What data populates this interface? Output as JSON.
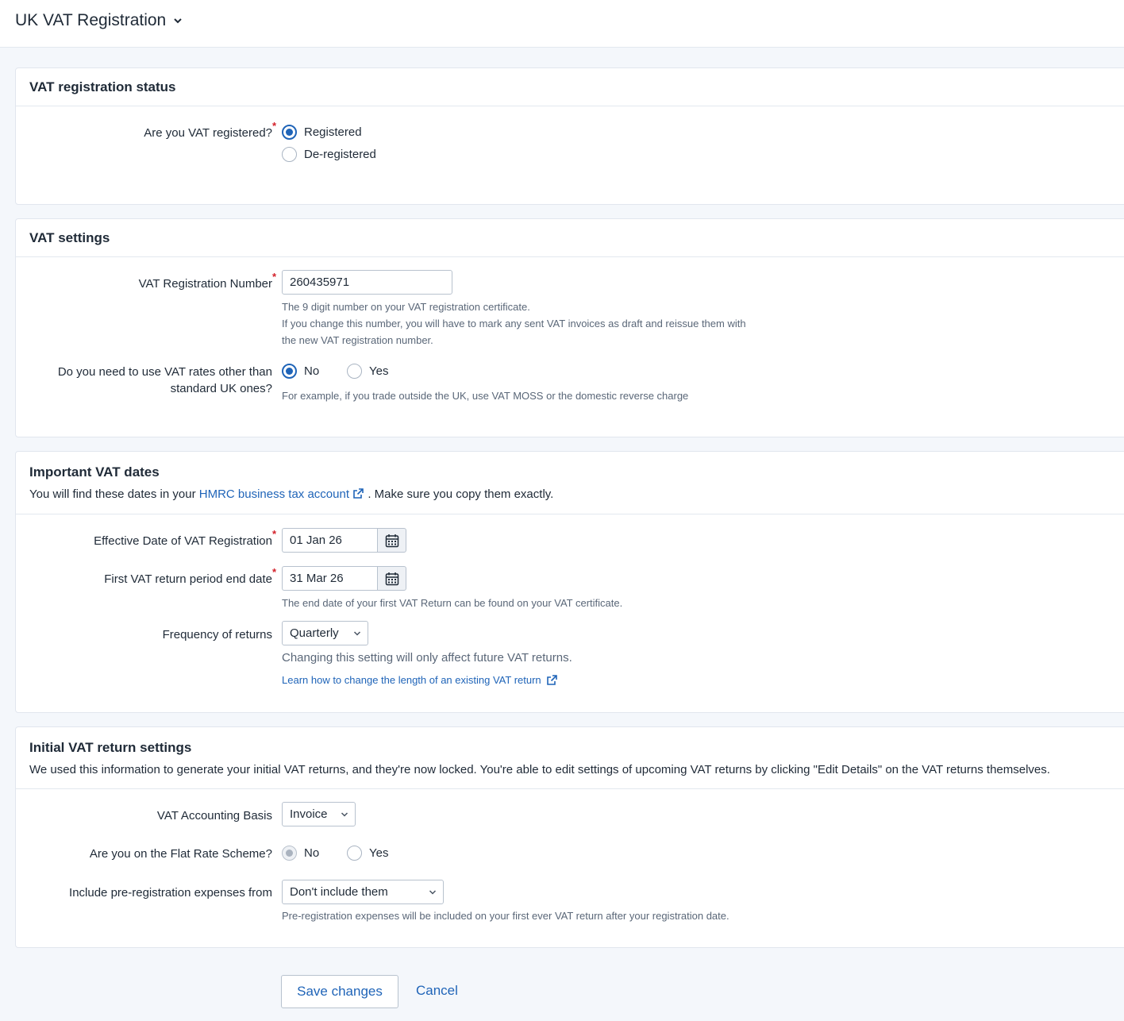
{
  "header": {
    "title": "UK VAT Registration"
  },
  "status_card": {
    "title": "VAT registration status",
    "question": "Are you VAT registered?",
    "options": [
      {
        "label": "Registered",
        "selected": true
      },
      {
        "label": "De-registered",
        "selected": false
      }
    ]
  },
  "settings_card": {
    "title": "VAT settings",
    "reg_number_label": "VAT Registration Number",
    "reg_number_value": "260435971",
    "reg_help_1": "The 9 digit number on your VAT registration certificate.",
    "reg_help_2": "If you change this number, you will have to mark any sent VAT invoices as draft and reissue them with",
    "reg_help_3": "the new VAT registration number.",
    "rates_label_1": "Do you need to use VAT rates other than",
    "rates_label_2": "standard UK ones?",
    "rates_options": [
      {
        "label": "No",
        "selected": true
      },
      {
        "label": "Yes",
        "selected": false
      }
    ],
    "rates_help": "For example, if you trade outside the UK, use VAT MOSS or the domestic reverse charge"
  },
  "dates_card": {
    "title": "Important VAT dates",
    "desc_prefix": "You will find these dates in your",
    "desc_link": "HMRC business tax account",
    "desc_suffix": ". Make sure you copy them exactly.",
    "effective_label": "Effective Date of VAT Registration",
    "effective_value": "01 Jan 26",
    "first_return_label": "First VAT return period end date",
    "first_return_value": "31 Mar 26",
    "first_return_help": "The end date of your first VAT Return can be found on your VAT certificate.",
    "frequency_label": "Frequency of returns",
    "frequency_value": "Quarterly",
    "frequency_help": "Changing this setting will only affect future VAT returns.",
    "frequency_link": "Learn how to change the length of an existing VAT return"
  },
  "initial_card": {
    "title": "Initial VAT return settings",
    "desc": "We used this information to generate your initial VAT returns, and they're now locked. You're able to edit settings of upcoming VAT returns by clicking \"Edit Details\" on the VAT returns themselves.",
    "basis_label": "VAT Accounting Basis",
    "basis_value": "Invoice",
    "flat_label": "Are you on the Flat Rate Scheme?",
    "flat_options": [
      {
        "label": "No",
        "selected": true
      },
      {
        "label": "Yes",
        "selected": false
      }
    ],
    "pre_label": "Include pre-registration expenses from",
    "pre_value": "Don't include them",
    "pre_help": "Pre-registration expenses will be included on your first ever VAT return after your registration date."
  },
  "actions": {
    "save": "Save changes",
    "cancel": "Cancel"
  },
  "colors": {
    "accent": "#1f64b8",
    "required": "#d3202a",
    "background": "#f4f7fb"
  }
}
